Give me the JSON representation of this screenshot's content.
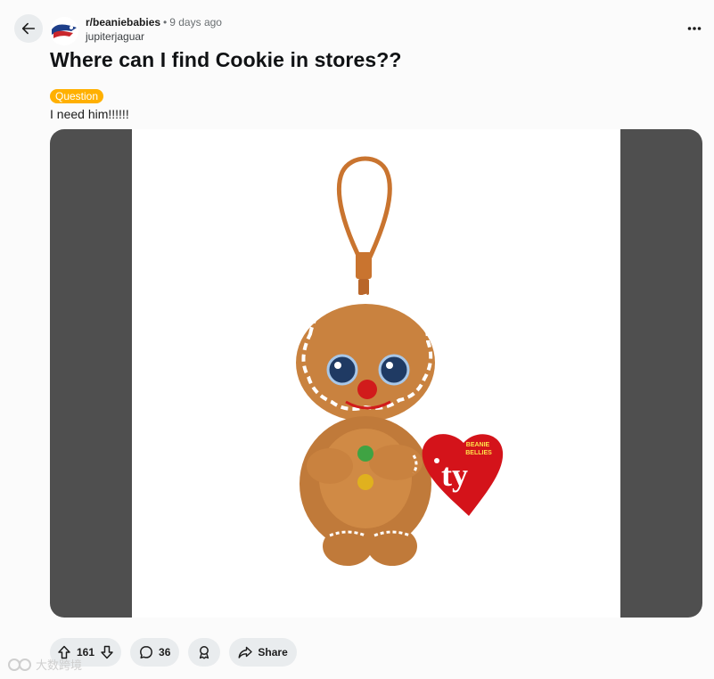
{
  "post": {
    "subreddit": "r/beaniebabies",
    "separator": "•",
    "age": "9 days ago",
    "author": "jupiterjaguar",
    "title": "Where can I find Cookie in stores??",
    "flair": "Question",
    "body": "I need him!!!!!!"
  },
  "media": {
    "tag_line1": "BEANIE",
    "tag_line2": "BELLIES",
    "tag_logo": "ty"
  },
  "actions": {
    "votes": "161",
    "comments": "36",
    "share": "Share"
  },
  "watermark": {
    "text": "大数跨境"
  },
  "icons": {
    "back": "back-arrow-icon",
    "more": "more-horizontal-icon",
    "upvote": "upvote-arrow-icon",
    "downvote": "downvote-arrow-icon",
    "comment": "comment-bubble-icon",
    "award": "award-icon",
    "share": "share-arrow-icon"
  },
  "colors": {
    "flair": "#ffb000",
    "pill": "#e9ecee",
    "media_bg": "#4f4f4f"
  }
}
